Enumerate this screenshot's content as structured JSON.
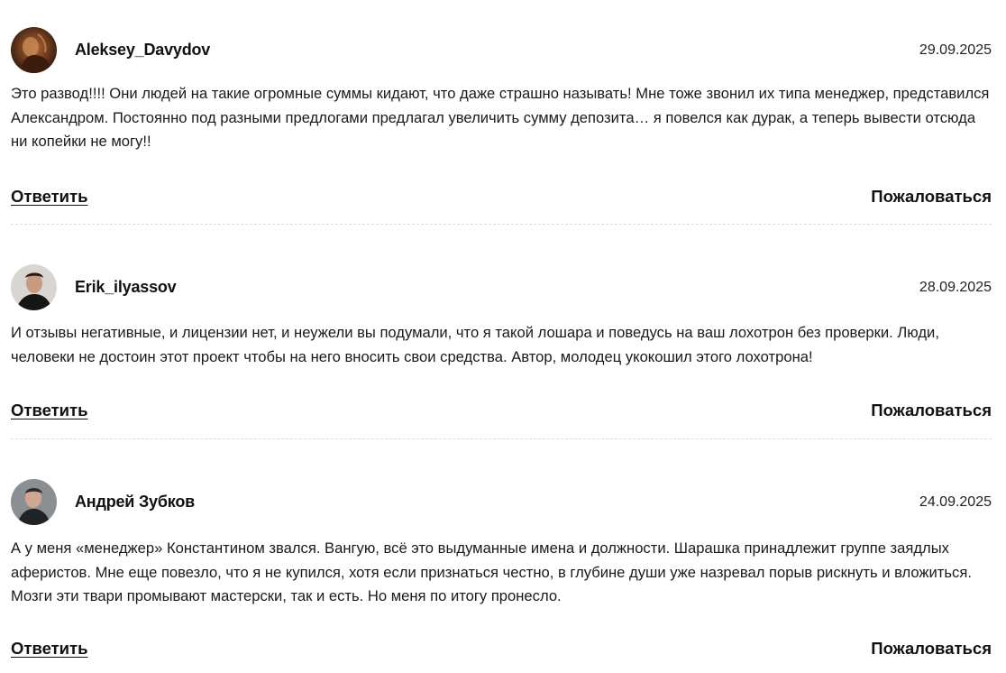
{
  "comments": [
    {
      "author": "Aleksey_Davydov",
      "date": "29.09.2025",
      "text": "Это развод!!!! Они людей на такие огромные суммы кидают, что даже страшно называть! Мне тоже звонил их типа менеджер, представился Александром. Постоянно под разными предлогами предлагал увеличить сумму депозита… я повелся как дурак, а теперь вывести отсюда ни копейки не могу!!",
      "reply_label": "Ответить",
      "report_label": "Пожаловаться",
      "avatar_icon": "user-photo-avatar"
    },
    {
      "author": "Erik_ilyassov",
      "date": "28.09.2025",
      "text": "И отзывы негативные, и лицензии нет, и неужели вы подумали, что я такой лошара и поведусь на ваш лохотрон без проверки. Люди, человеки не достоин этот проект чтобы на него вносить свои средства. Автор, молодец укокошил этого лохотрона!",
      "reply_label": "Ответить",
      "report_label": "Пожаловаться",
      "avatar_icon": "user-photo-avatar"
    },
    {
      "author": "Андрей Зубков",
      "date": "24.09.2025",
      "text": "А у меня «менеджер» Константином звался. Вангую, всё это выдуманные имена и должности. Шарашка принадлежит группе заядлых аферистов. Мне еще повезло, что я не купился, хотя если признаться честно, в глубине души уже назревал порыв рискнуть и вложиться. Мозги эти твари промывают мастерски, так и есть. Но меня по итогу пронесло.",
      "reply_label": "Ответить",
      "report_label": "Пожаловаться",
      "avatar_icon": "user-photo-avatar"
    }
  ],
  "colors": {
    "text": "#111111",
    "divider": "#dcdcdc",
    "background": "#ffffff"
  }
}
